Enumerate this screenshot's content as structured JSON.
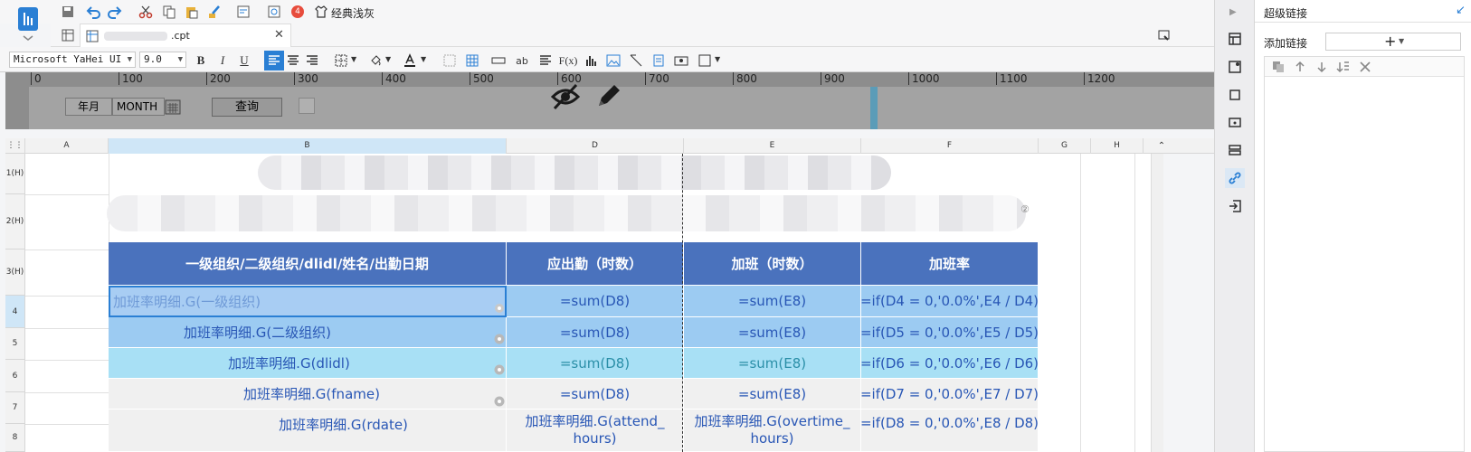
{
  "app": {
    "logo": "app-logo-icon"
  },
  "toolbar": {
    "badge_count": "4",
    "theme_label": "经典浅灰",
    "font_family": "Microsoft YaHei UI",
    "font_size": "9.0"
  },
  "tab": {
    "file_name": ".cpt"
  },
  "ruler": {
    "ticks": [
      "0",
      "100",
      "200",
      "300",
      "400",
      "500",
      "600",
      "700",
      "800",
      "900",
      "1000",
      "1100",
      "1200"
    ]
  },
  "params": {
    "year_month_label": "年月",
    "month_widget": "MONTH",
    "query_button": "查询"
  },
  "grid": {
    "columns": [
      "A",
      "B",
      "D",
      "E",
      "F",
      "G",
      "H"
    ],
    "rows": [
      "1(H)",
      "2(H)",
      "3(H)",
      "4",
      "5",
      "6",
      "7",
      "8"
    ],
    "header_cells": [
      "一级组织/二级组织/dlidl/姓名/出勤日期",
      "应出勤（时数）",
      "加班（时数）",
      "加班率"
    ],
    "title_badge": "②",
    "data_rows": [
      {
        "b": "加班率明细.G(一级组织)",
        "d": "=sum(D8)",
        "e": "=sum(E8)",
        "f": "=if(D4 = 0,'0.0%',E4 / D4)"
      },
      {
        "b": "加班率明细.G(二级组织)",
        "d": "=sum(D8)",
        "e": "=sum(E8)",
        "f": "=if(D5 = 0,'0.0%',E5 / D5)"
      },
      {
        "b": "加班率明细.G(dlidl)",
        "d": "=sum(D8)",
        "e": "=sum(E8)",
        "f": "=if(D6 = 0,'0.0%',E6 / D6)"
      },
      {
        "b": "加班率明细.G(fname)",
        "d": "=sum(D8)",
        "e": "=sum(E8)",
        "f": "=if(D7 = 0,'0.0%',E7 / D7)"
      },
      {
        "b": "加班率明细.G(rdate)",
        "d": "加班率明细.G(attend_",
        "e": "加班率明细.G(overtime_",
        "f": "=if(D8 = 0,'0.0%',E8 / D8)"
      }
    ],
    "row8_wrap": {
      "d": "hours)",
      "e": "hours)"
    }
  },
  "panel": {
    "title": "超级链接",
    "add_link_label": "添加链接"
  },
  "colors": {
    "header_blue": "#4a72bd",
    "row4": "#a8cdf3",
    "row5": "#9ccbf2",
    "row6": "#a8e0f5",
    "row7": "#f0f0f0",
    "accent": "#2a7fd4"
  }
}
